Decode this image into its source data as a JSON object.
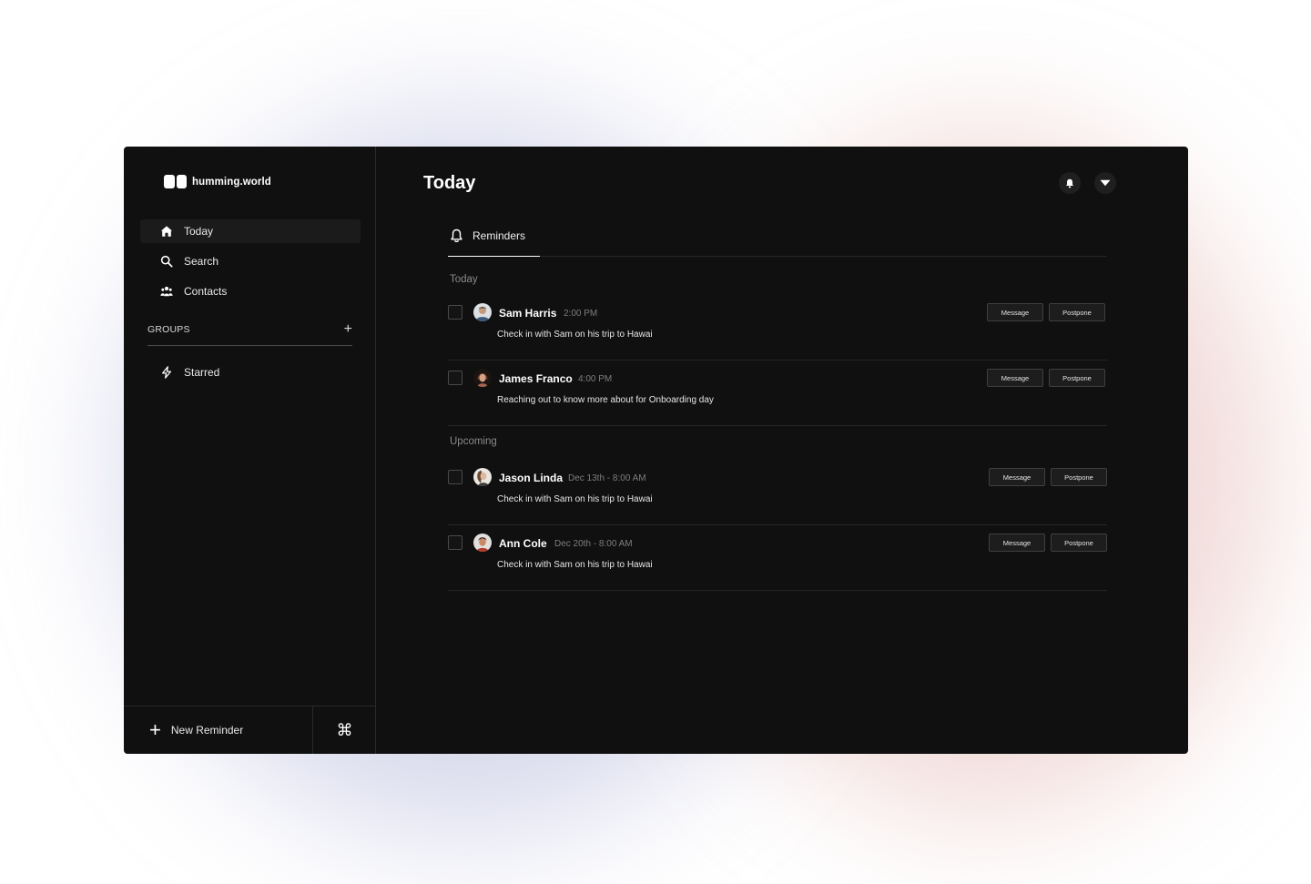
{
  "app": {
    "brand": "humming.world",
    "colors": {
      "background": "#101010",
      "panel": "#1b1b1b",
      "text": "#ffffff",
      "muted": "#7d7d7d",
      "border": "#262626"
    }
  },
  "sidebar": {
    "items": [
      {
        "label": "Today",
        "icon": "home-icon",
        "active": true
      },
      {
        "label": "Search",
        "icon": "search-icon",
        "active": false
      },
      {
        "label": "Contacts",
        "icon": "contacts-icon",
        "active": false
      }
    ],
    "groups_label": "GROUPS",
    "groups": [
      {
        "label": "Starred",
        "icon": "bolt-icon"
      }
    ],
    "footer": {
      "new_reminder": "New Reminder",
      "command_icon": "command-icon"
    }
  },
  "header": {
    "title": "Today"
  },
  "tabs": [
    {
      "label": "Reminders",
      "icon": "bell-outline-icon",
      "active": true
    }
  ],
  "sections": [
    {
      "label": "Today",
      "reminders": [
        {
          "name": "Sam Harris",
          "time": "2:00 PM",
          "note": "Check in with Sam on his trip to Hawai",
          "message": "Message",
          "postpone": "Postpone"
        },
        {
          "name": "James Franco",
          "time": "4:00 PM",
          "note": "Reaching out to know more about for Onboarding day",
          "message": "Message",
          "postpone": "Postpone"
        }
      ]
    },
    {
      "label": "Upcoming",
      "reminders": [
        {
          "name": "Jason Linda",
          "time": "Dec 13th - 8:00 AM",
          "note": "Check in with Sam on his trip to Hawai",
          "message": "Message",
          "postpone": "Postpone"
        },
        {
          "name": "Ann Cole",
          "time": "Dec 20th - 8:00 AM",
          "note": "Check in with Sam on his trip to Hawai",
          "message": "Message",
          "postpone": "Postpone"
        }
      ]
    }
  ]
}
